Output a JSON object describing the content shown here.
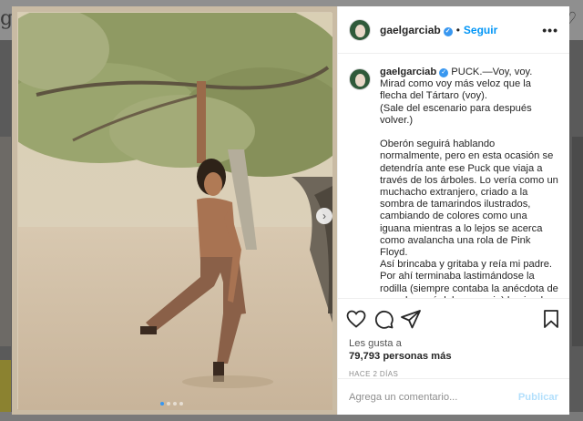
{
  "background": {
    "logo_text": "g",
    "heart_icon": "heart-icon"
  },
  "post": {
    "username": "gaelgarciab",
    "separator": "•",
    "follow_label": "Seguir",
    "more_label": "•••",
    "caption": "PUCK.—Voy, voy. Mirad como voy más veloz que la flecha del Tártaro (voy).\n(Sale del escenario para después volver.)\n\nOberón seguirá hablando normalmente, pero en esta ocasión se detendría ante ese Puck que viaja a través de los árboles. Lo vería como un muchacho extranjero, criado a la sombra de tamarindos ilustrados, cambiando de colores como una iguana mientras a lo lejos se acerca como avalancha una rola de Pink Floyd.\nAsí brincaba y gritaba y reía mi padre. Por ahí terminaba lastimándose la rodilla (siempre contaba la anécdota de cuando cayó del escenario) haciendo",
    "likes_first": "Les gusta a ",
    "likes_count": "79,793 personas más",
    "time": "HACE 2 DÍAS",
    "comment_placeholder": "Agrega un comentario...",
    "publish_label": "Publicar",
    "carousel": {
      "slides": 4,
      "active": 0
    }
  },
  "colors": {
    "accent": "#0095f6",
    "publish_disabled": "#b2dffc",
    "dot_active": "#3897f0"
  }
}
